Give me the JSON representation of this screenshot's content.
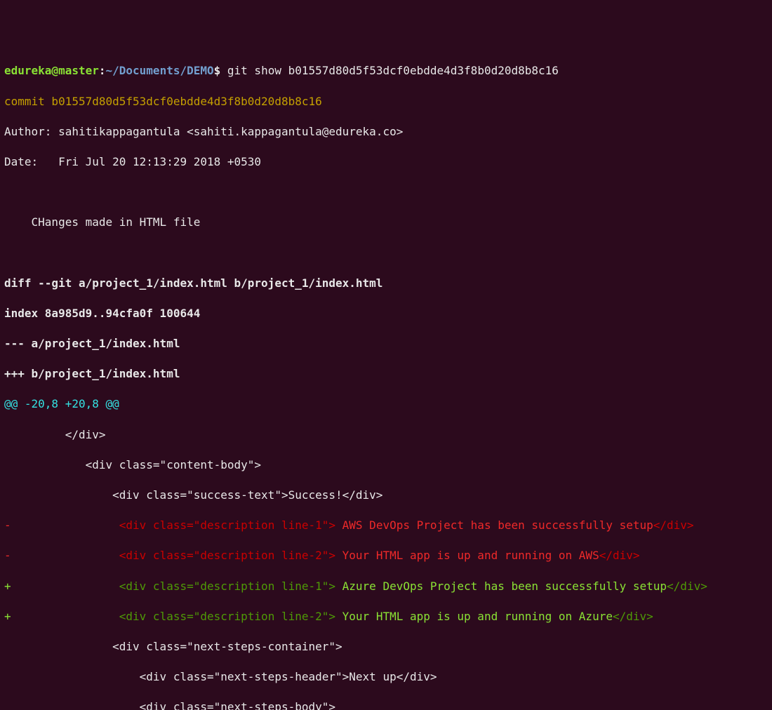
{
  "prompt": {
    "user_host": "edureka@master",
    "sep1": ":",
    "path": "~/Documents/DEMO",
    "dollar": "$",
    "command": " git show b01557d80d5f53dcf0ebdde4d3f8b0d20d8b8c16"
  },
  "commit": {
    "line": "commit b01557d80d5f53dcf0ebdde4d3f8b0d20d8b8c16",
    "author": "Author: sahitikappagantula <sahiti.kappagantula@edureka.co>",
    "date": "Date:   Fri Jul 20 12:13:29 2018 +0530",
    "message": "    CHanges made in HTML file"
  },
  "diff": {
    "header": "diff --git a/project_1/index.html b/project_1/index.html",
    "index": "index 8a985d9..94cfa0f 100644",
    "minus_file": "--- a/project_1/index.html",
    "plus_file": "+++ b/project_1/index.html",
    "hunk": "@@ -20,8 +20,8 @@",
    "ctx1": "         </div>",
    "ctx2": "            <div class=\"content-body\">",
    "ctx3": "                <div class=\"success-text\">Success!</div>",
    "del1_prefix": "-",
    "del1_open": "                <div class=\"description line-1\">",
    "del1_text": " AWS DevOps Project has been successfully setup",
    "del1_close": "</div>",
    "del2_prefix": "-",
    "del2_open": "                <div class=\"description line-2\">",
    "del2_text": " Your HTML app is up and running on AWS",
    "del2_close": "</div>",
    "add1_prefix": "+",
    "add1_open": "                <div class=\"description line-1\">",
    "add1_text": " Azure DevOps Project has been successfully setup",
    "add1_close": "</div>",
    "add2_prefix": "+",
    "add2_open": "                <div class=\"description line-2\">",
    "add2_text": " Your HTML app is up and running on Azure",
    "add2_close": "</div>",
    "ctx4": "                <div class=\"next-steps-container\">",
    "ctx5": "                    <div class=\"next-steps-header\">Next up</div>",
    "ctx6": "                    <div class=\"next-steps-body\">"
  }
}
